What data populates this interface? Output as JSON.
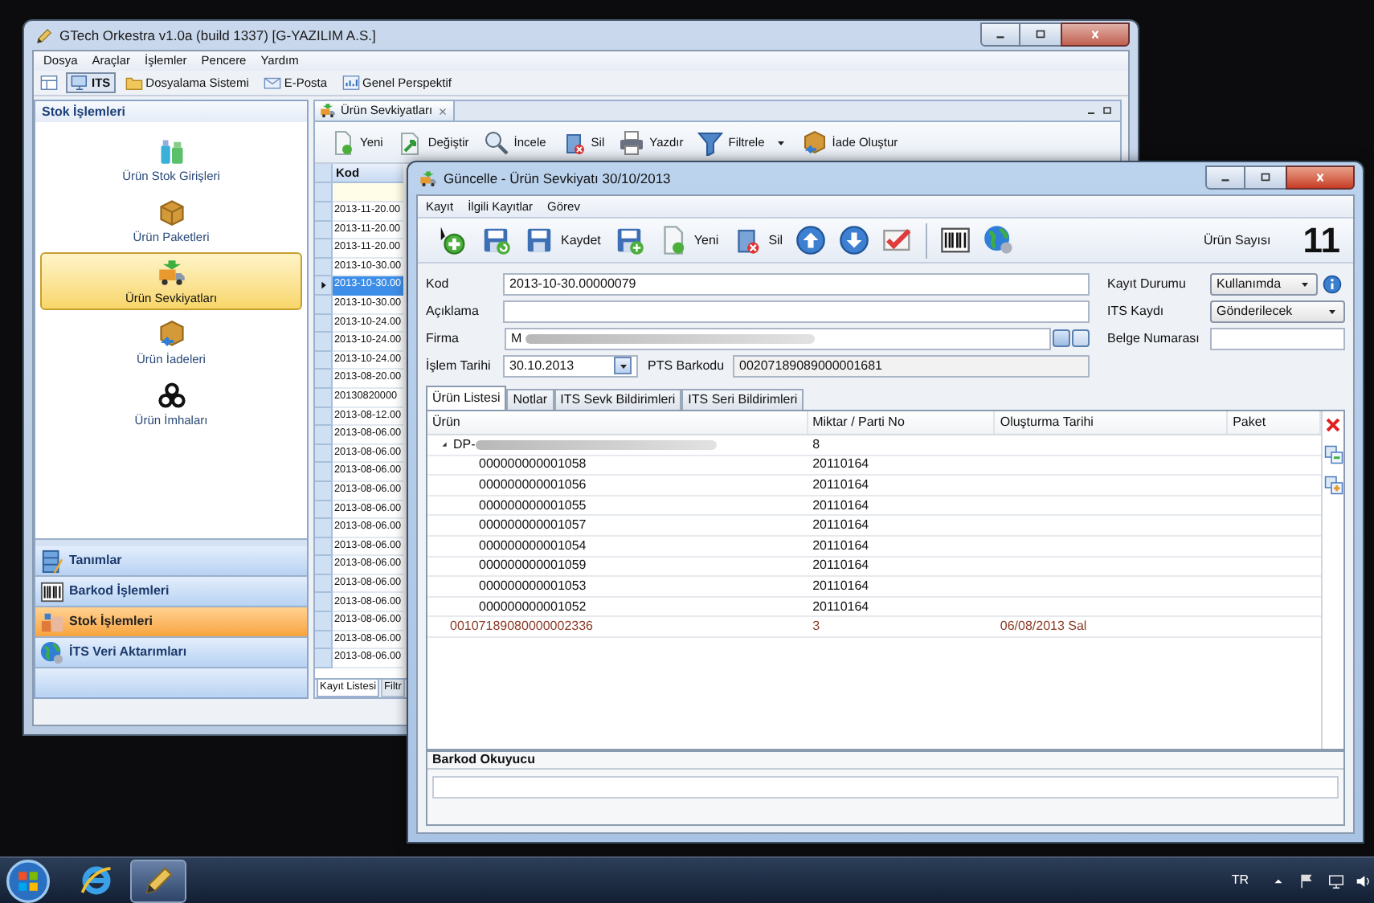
{
  "main_window": {
    "title": "GTech Orkestra v1.0a (build 1337) [G-YAZILIM A.S.]",
    "menu": [
      "Dosya",
      "Araçlar",
      "İşlemler",
      "Pencere",
      "Yardım"
    ],
    "perspectives": [
      {
        "label": "ITS",
        "selected": true
      },
      {
        "label": "Dosyalama Sistemi",
        "selected": false
      },
      {
        "label": "E-Posta",
        "selected": false
      },
      {
        "label": "Genel Perspektif",
        "selected": false
      }
    ],
    "navigator": {
      "title": "Stok İşlemleri",
      "items": [
        {
          "label": "Ürün Stok Girişleri",
          "selected": false
        },
        {
          "label": "Ürün Paketleri",
          "selected": false
        },
        {
          "label": "Ürün Sevkiyatları",
          "selected": true
        },
        {
          "label": "Ürün İadeleri",
          "selected": false
        },
        {
          "label": "Ürün İmhaları",
          "selected": false
        }
      ],
      "groups": [
        {
          "label": "Tanımlar",
          "selected": false
        },
        {
          "label": "Barkod İşlemleri",
          "selected": false
        },
        {
          "label": "Stok İşlemleri",
          "selected": true
        },
        {
          "label": "İTS Veri Aktarımları",
          "selected": false
        }
      ]
    },
    "editor": {
      "tab": "Ürün Sevkiyatları",
      "toolbar": [
        {
          "label": "Yeni",
          "dropdown": false
        },
        {
          "label": "Değiştir",
          "dropdown": false
        },
        {
          "label": "İncele",
          "dropdown": false
        },
        {
          "label": "Sil",
          "dropdown": false
        },
        {
          "label": "Yazdır",
          "dropdown": false
        },
        {
          "label": "Filtrele",
          "dropdown": true
        },
        {
          "label": "İade Oluştur",
          "dropdown": false
        }
      ],
      "grid": {
        "columns": [
          "Kod"
        ],
        "rows": [
          {
            "kod": "2013-11-20.00",
            "selected": false
          },
          {
            "kod": "2013-11-20.00",
            "selected": false
          },
          {
            "kod": "2013-11-20.00",
            "selected": false
          },
          {
            "kod": "2013-10-30.00",
            "selected": false
          },
          {
            "kod": "2013-10-30.00",
            "selected": true
          },
          {
            "kod": "2013-10-30.00",
            "selected": false
          },
          {
            "kod": "2013-10-24.00",
            "selected": false
          },
          {
            "kod": "2013-10-24.00",
            "selected": false
          },
          {
            "kod": "2013-10-24.00",
            "selected": false
          },
          {
            "kod": "2013-08-20.00",
            "selected": false
          },
          {
            "kod": "20130820000",
            "selected": false
          },
          {
            "kod": "2013-08-12.00",
            "selected": false
          },
          {
            "kod": "2013-08-06.00",
            "selected": false
          },
          {
            "kod": "2013-08-06.00",
            "selected": false
          },
          {
            "kod": "2013-08-06.00",
            "selected": false
          },
          {
            "kod": "2013-08-06.00",
            "selected": false
          },
          {
            "kod": "2013-08-06.00",
            "selected": false
          },
          {
            "kod": "2013-08-06.00",
            "selected": false
          },
          {
            "kod": "2013-08-06.00",
            "selected": false
          },
          {
            "kod": "2013-08-06.00",
            "selected": false
          },
          {
            "kod": "2013-08-06.00",
            "selected": false
          },
          {
            "kod": "2013-08-06.00",
            "selected": false
          },
          {
            "kod": "2013-08-06.00",
            "selected": false
          },
          {
            "kod": "2013-08-06.00",
            "selected": false
          },
          {
            "kod": "2013-08-06.00",
            "selected": false
          }
        ]
      },
      "bottom_tabs": [
        {
          "label": "Kayıt Listesi",
          "selected": true
        },
        {
          "label": "Filtr",
          "selected": false
        }
      ]
    }
  },
  "dialog": {
    "title": "Güncelle - Ürün Sevkiyatı 30/10/2013",
    "menu": [
      "Kayıt",
      "İlgili Kayıtlar",
      "Görev"
    ],
    "toolbar": [
      {
        "kind": "icon"
      },
      {
        "kind": "icon"
      },
      {
        "kind": "button",
        "label": "Kaydet"
      },
      {
        "kind": "icon"
      },
      {
        "kind": "button",
        "label": "Yeni"
      },
      {
        "kind": "button",
        "label": "Sil"
      },
      {
        "kind": "icon"
      },
      {
        "kind": "icon"
      },
      {
        "kind": "icon"
      },
      {
        "kind": "separator"
      },
      {
        "kind": "icon"
      },
      {
        "kind": "icon"
      }
    ],
    "counter": {
      "label": "Ürün Sayısı",
      "value": "11"
    },
    "kod": {
      "label": "Kod",
      "value": "2013-10-30.00000079"
    },
    "aciklama": {
      "label": "Açıklama"
    },
    "firma": {
      "label": "Firma",
      "value": "M",
      "redacted": true
    },
    "islem_tarihi": {
      "label": "İşlem Tarihi",
      "value": "30.10.2013"
    },
    "pts_barkodu": {
      "label": "PTS Barkodu",
      "value": "00207189089000001681"
    },
    "kayit_durumu": {
      "label": "Kayıt Durumu",
      "value": "Kullanımda"
    },
    "its_kaydi": {
      "label": "ITS Kaydı",
      "value": "Gönderilecek"
    },
    "belge_numarasi": {
      "label": "Belge Numarası"
    },
    "tabs": [
      {
        "label": "Ürün Listesi",
        "selected": true
      },
      {
        "label": "Notlar",
        "selected": false
      },
      {
        "label": "ITS Sevk Bildirimleri",
        "selected": false
      },
      {
        "label": "ITS Seri Bildirimleri",
        "selected": false
      }
    ],
    "table": {
      "columns": [
        "Ürün",
        "Miktar / Parti No",
        "Oluşturma Tarihi",
        "Paket"
      ],
      "rows": [
        {
          "kind": "product",
          "urun": "DP-",
          "redacted": true,
          "expanded": true,
          "miktar": "8",
          "children": [
            {
              "urun": "000000000001058",
              "miktar": "20110164"
            },
            {
              "urun": "000000000001056",
              "miktar": "20110164"
            },
            {
              "urun": "000000000001055",
              "miktar": "20110164"
            },
            {
              "urun": "000000000001057",
              "miktar": "20110164"
            },
            {
              "urun": "000000000001054",
              "miktar": "20110164"
            },
            {
              "urun": "000000000001059",
              "miktar": "20110164"
            },
            {
              "urun": "000000000001053",
              "miktar": "20110164"
            },
            {
              "urun": "000000000001052",
              "miktar": "20110164"
            }
          ]
        },
        {
          "kind": "package",
          "urun": "00107189080000002336",
          "redacted": false,
          "miktar": "3",
          "tarih": "06/08/2013 Sal"
        }
      ]
    },
    "barcode_panel": {
      "title": "Barkod Okuyucu"
    }
  },
  "taskbar": {
    "language": "TR"
  }
}
